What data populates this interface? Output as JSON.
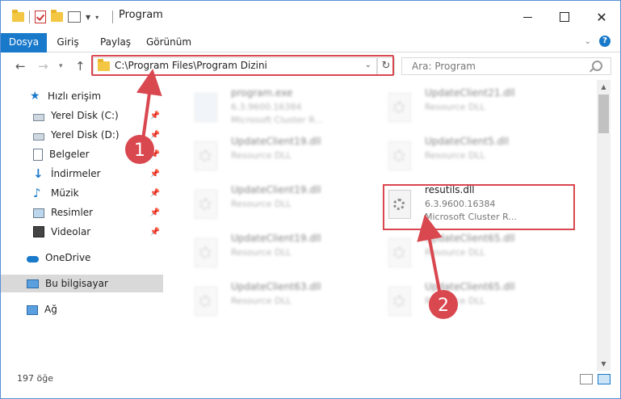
{
  "window": {
    "title": "Program",
    "minimize_glyph": "—",
    "maximize_glyph": "☐",
    "close_glyph": "✕"
  },
  "ribbon": {
    "tabs": [
      {
        "label": "Dosya"
      },
      {
        "label": "Giriş"
      },
      {
        "label": "Paylaş"
      },
      {
        "label": "Görünüm"
      }
    ]
  },
  "address": {
    "path": "C:\\Program Files\\Program Dizini",
    "search_placeholder": "Ara: Program"
  },
  "sidebar": {
    "items": [
      {
        "label": "Hızlı erişim",
        "icon": "star-icon"
      },
      {
        "label": "Yerel Disk (C:)",
        "icon": "disk-icon",
        "pinned": true
      },
      {
        "label": "Yerel Disk (D:)",
        "icon": "disk-icon",
        "pinned": true
      },
      {
        "label": "Belgeler",
        "icon": "document-icon",
        "pinned": true
      },
      {
        "label": "İndirmeler",
        "icon": "download-icon",
        "pinned": true
      },
      {
        "label": "Müzik",
        "icon": "music-icon",
        "pinned": true
      },
      {
        "label": "Resimler",
        "icon": "picture-icon",
        "pinned": true
      },
      {
        "label": "Videolar",
        "icon": "video-icon",
        "pinned": true
      },
      {
        "label": "OneDrive",
        "icon": "cloud-icon"
      },
      {
        "label": "Bu bilgisayar",
        "icon": "computer-icon",
        "selected": true
      },
      {
        "label": "Ağ",
        "icon": "network-icon"
      }
    ]
  },
  "files": [
    {
      "name": "program.exe",
      "line1": "6.3.9600.16384",
      "line2": "Microsoft Cluster R...",
      "blurred": true
    },
    {
      "name": "UpdateClient21.dll",
      "line1": "Resource DLL",
      "blurred": true
    },
    {
      "name": "UpdateClient19.dll",
      "line1": "Resource DLL",
      "blurred": true
    },
    {
      "name": "UpdateClient5.dll",
      "line1": "Resource DLL",
      "blurred": true
    },
    {
      "name": "UpdateClient19.dll",
      "line1": "Resource DLL",
      "blurred": true
    },
    {
      "name": "resutils.dll",
      "line1": "6.3.9600.16384",
      "line2": "Microsoft Cluster R...",
      "blurred": false
    },
    {
      "name": "UpdateClient19.dll",
      "line1": "Resource DLL",
      "blurred": true
    },
    {
      "name": "UpdateClient65.dll",
      "line1": "Resource DLL",
      "blurred": true
    },
    {
      "name": "UpdateClient63.dll",
      "line1": "Resource DLL",
      "blurred": true
    },
    {
      "name": "UpdateClient65.dll",
      "line1": "Resource DLL",
      "blurred": true
    }
  ],
  "status": {
    "item_count": "197 öğe"
  },
  "annotations": {
    "marker1": "1",
    "marker2": "2",
    "color": "#d9474f"
  }
}
